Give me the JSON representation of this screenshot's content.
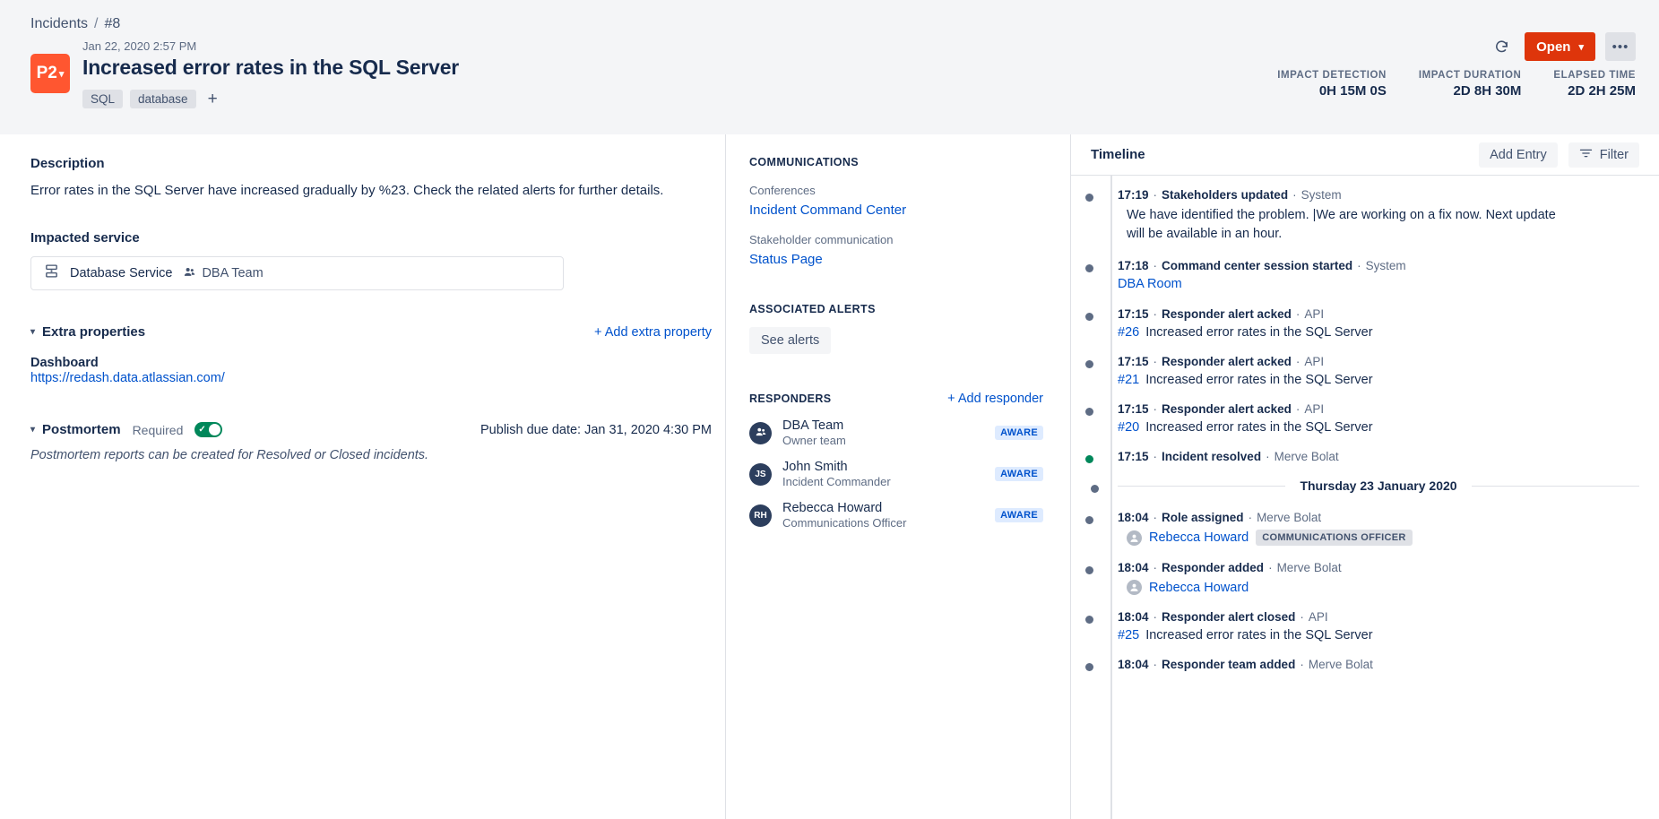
{
  "breadcrumb": {
    "root": "Incidents",
    "separator": "/",
    "current": "#8"
  },
  "header": {
    "priority": "P2",
    "date": "Jan 22, 2020 2:57 PM",
    "title": "Increased error rates in the SQL Server",
    "tags": [
      "SQL",
      "database"
    ],
    "add_tag_label": "+",
    "status_label": "Open",
    "more_label": "•••",
    "metrics": [
      {
        "label": "IMPACT DETECTION",
        "value": "0H 15M 0S"
      },
      {
        "label": "IMPACT DURATION",
        "value": "2D 8H 30M"
      },
      {
        "label": "ELAPSED TIME",
        "value": "2D 2H 25M"
      }
    ]
  },
  "description": {
    "heading": "Description",
    "text": "Error rates in the SQL Server have increased gradually by %23. Check the related alerts for further details."
  },
  "impacted_service": {
    "heading": "Impacted service",
    "service_name": "Database Service",
    "team_name": "DBA Team"
  },
  "extra_properties": {
    "heading": "Extra properties",
    "add_label": "+ Add extra property",
    "properties": [
      {
        "name": "Dashboard",
        "value": "https://redash.data.atlassian.com/"
      }
    ]
  },
  "postmortem": {
    "heading": "Postmortem",
    "required_label": "Required",
    "toggle_on": true,
    "due_label": "Publish due date:",
    "due_value": "Jan 31, 2020 4:30 PM",
    "note": "Postmortem reports can be created for Resolved or Closed incidents."
  },
  "communications": {
    "heading": "COMMUNICATIONS",
    "conferences_label": "Conferences",
    "conference_link": "Incident Command Center",
    "stakeholder_label": "Stakeholder communication",
    "stakeholder_link": "Status Page"
  },
  "associated_alerts": {
    "heading": "ASSOCIATED ALERTS",
    "button_label": "See alerts"
  },
  "responders": {
    "heading": "RESPONDERS",
    "add_label": "+ Add responder",
    "items": [
      {
        "initials": "",
        "icon": "team-icon",
        "name": "DBA Team",
        "role": "Owner team",
        "status": "AWARE"
      },
      {
        "initials": "JS",
        "icon": "",
        "name": "John Smith",
        "role": "Incident Commander",
        "status": "AWARE"
      },
      {
        "initials": "RH",
        "icon": "",
        "name": "Rebecca Howard",
        "role": "Communications Officer",
        "status": "AWARE"
      }
    ]
  },
  "timeline": {
    "heading": "Timeline",
    "add_entry_label": "Add Entry",
    "filter_label": "Filter",
    "entries": [
      {
        "kind": "text",
        "time": "17:19",
        "action": "Stakeholders updated",
        "actor": "System",
        "dot": "gray",
        "body": "We have identified the problem. |We are working on a fix now. Next update will be available in an hour."
      },
      {
        "kind": "link",
        "time": "17:18",
        "action": "Command center session started",
        "actor": "System",
        "dot": "gray",
        "link_text": "DBA Room"
      },
      {
        "kind": "alert",
        "time": "17:15",
        "action": "Responder alert acked",
        "actor": "API",
        "dot": "gray",
        "alert_id": "#26",
        "alert_title": "Increased error rates in the SQL Server"
      },
      {
        "kind": "alert",
        "time": "17:15",
        "action": "Responder alert acked",
        "actor": "API",
        "dot": "gray",
        "alert_id": "#21",
        "alert_title": "Increased error rates in the SQL Server"
      },
      {
        "kind": "alert",
        "time": "17:15",
        "action": "Responder alert acked",
        "actor": "API",
        "dot": "gray",
        "alert_id": "#20",
        "alert_title": "Increased error rates in the SQL Server"
      },
      {
        "kind": "plain",
        "time": "17:15",
        "action": "Incident resolved",
        "actor": "Merve Bolat",
        "dot": "green"
      },
      {
        "kind": "divider",
        "date_label": "Thursday 23 January 2020"
      },
      {
        "kind": "person",
        "time": "18:04",
        "action": "Role assigned",
        "actor": "Merve Bolat",
        "dot": "gray",
        "person": "Rebecca Howard",
        "role_badge": "COMMUNICATIONS OFFICER"
      },
      {
        "kind": "person",
        "time": "18:04",
        "action": "Responder added",
        "actor": "Merve Bolat",
        "dot": "gray",
        "person": "Rebecca Howard",
        "role_badge": ""
      },
      {
        "kind": "alert",
        "time": "18:04",
        "action": "Responder alert closed",
        "actor": "API",
        "dot": "gray",
        "alert_id": "#25",
        "alert_title": "Increased error rates in the SQL Server"
      },
      {
        "kind": "plain",
        "time": "18:04",
        "action": "Responder team added",
        "actor": "Merve Bolat",
        "dot": "gray"
      }
    ]
  }
}
